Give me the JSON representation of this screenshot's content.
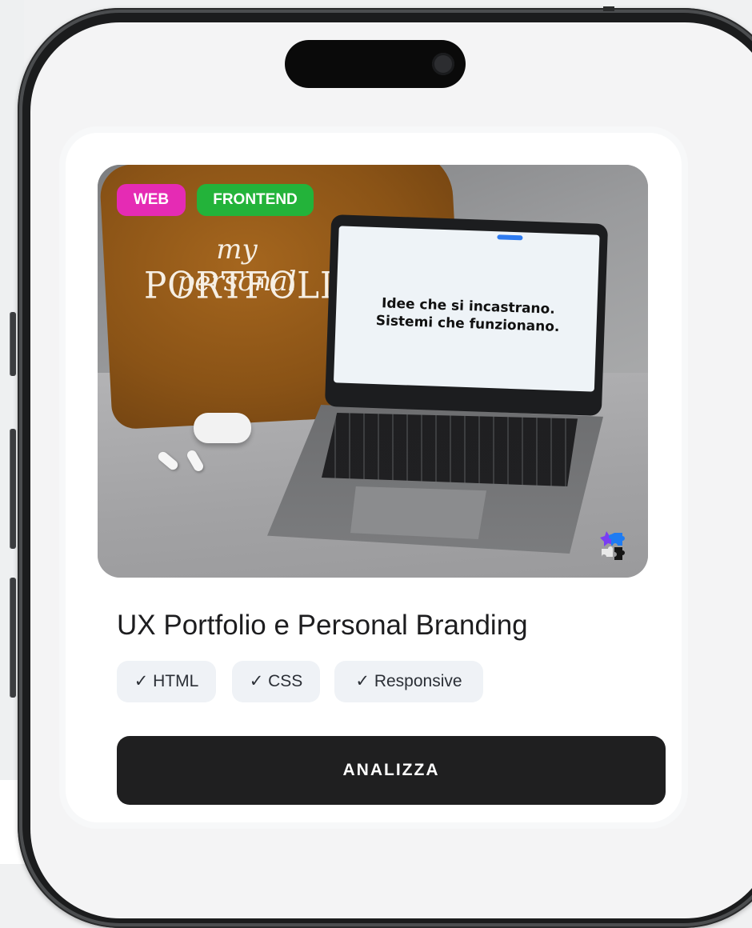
{
  "card": {
    "tags": [
      "WEB",
      "FRONTEND"
    ],
    "image": {
      "pillow_script": "my personal",
      "pillow_title": "PORTFOLIO",
      "laptop_headline_1": "Idee che si incastrano.",
      "laptop_headline_2": "Sistemi che funzionano.",
      "puzzle_icon": "puzzle-icon"
    },
    "title": "UX Portfolio e Personal Branding",
    "skills": [
      "✓ HTML",
      "✓ CSS",
      "✓ Responsive"
    ],
    "cta_label": "ANALIZZA"
  },
  "colors": {
    "tag_web": "#e52bb4",
    "tag_frontend": "#23b33a",
    "cta_bg": "#1f1f20",
    "chip_bg": "#eff2f6"
  }
}
